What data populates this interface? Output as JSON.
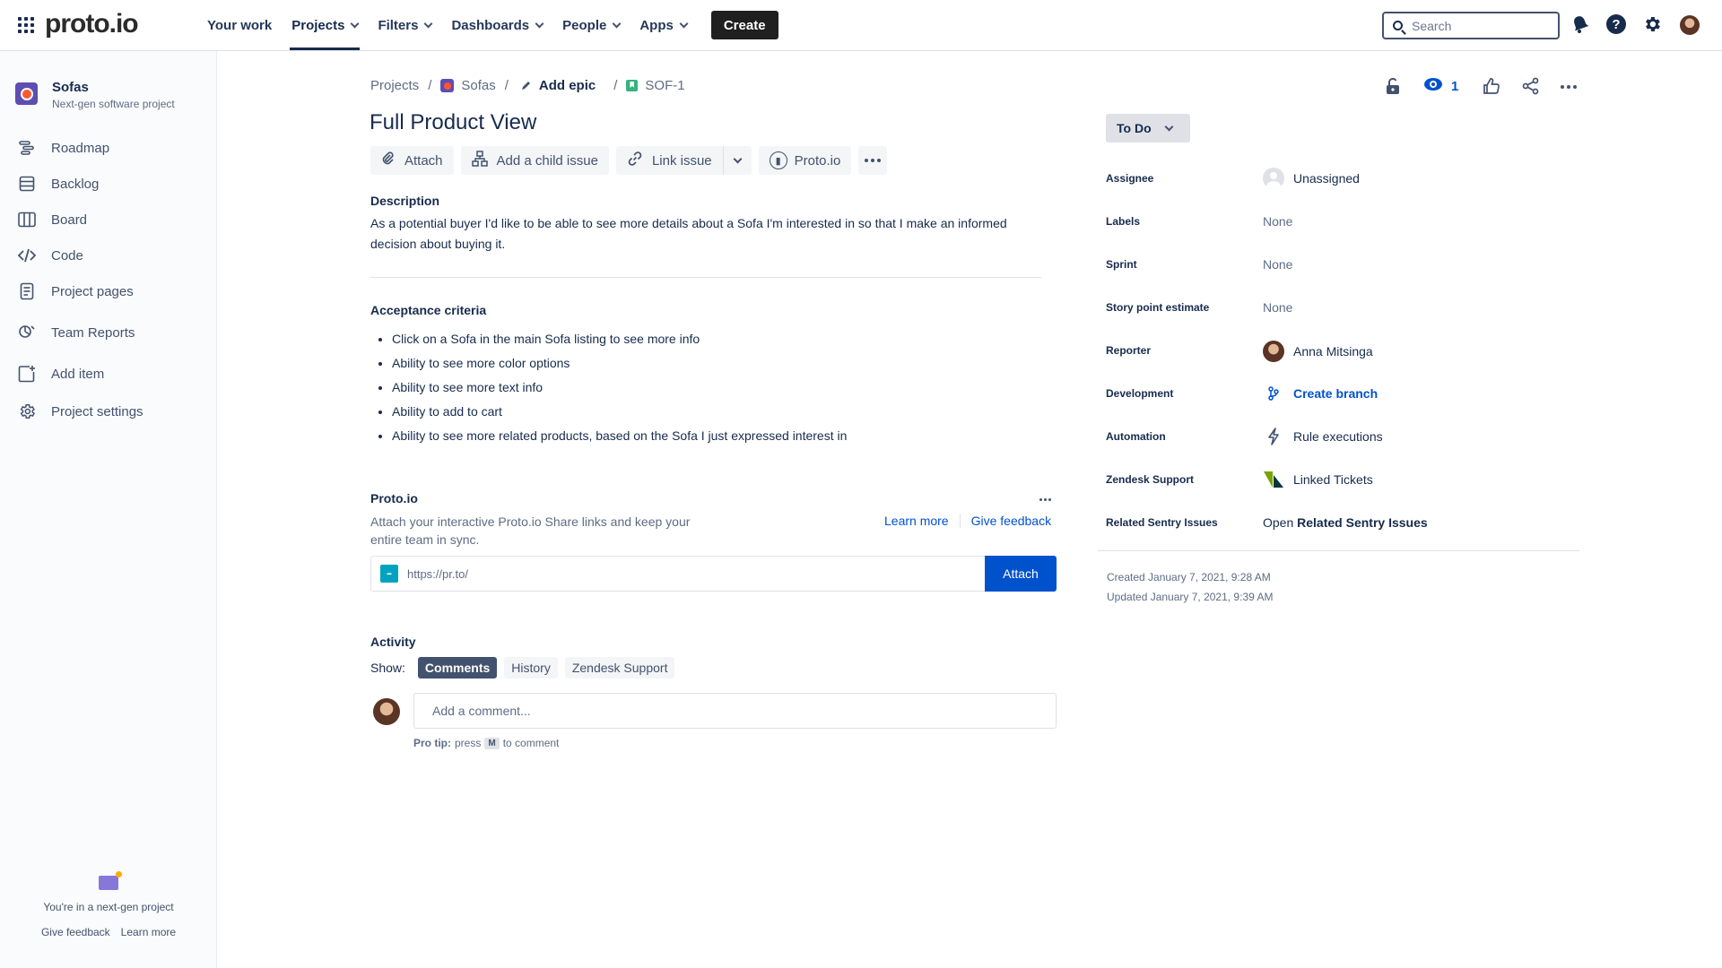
{
  "topnav": {
    "logo": "proto.io",
    "items": [
      {
        "label": "Your work"
      },
      {
        "label": "Projects"
      },
      {
        "label": "Filters"
      },
      {
        "label": "Dashboards"
      },
      {
        "label": "People"
      },
      {
        "label": "Apps"
      }
    ],
    "create_label": "Create",
    "search_placeholder": "Search",
    "help_glyph": "?"
  },
  "sidebar": {
    "project_name": "Sofas",
    "project_type": "Next-gen software project",
    "items": [
      {
        "label": "Roadmap",
        "icon": "roadmap-icon"
      },
      {
        "label": "Backlog",
        "icon": "backlog-icon"
      },
      {
        "label": "Board",
        "icon": "board-icon"
      },
      {
        "label": "Code",
        "icon": "code-icon"
      },
      {
        "label": "Project pages",
        "icon": "pages-icon"
      },
      {
        "label": "Team Reports",
        "icon": "reports-icon"
      },
      {
        "label": "Add item",
        "icon": "add-item-icon"
      },
      {
        "label": "Project settings",
        "icon": "settings-icon"
      }
    ],
    "footer_text": "You're in a next-gen project",
    "footer_feedback": "Give feedback",
    "footer_learn": "Learn more"
  },
  "breadcrumb": {
    "projects": "Projects",
    "project": "Sofas",
    "epic": "Add epic",
    "issue_key": "SOF-1",
    "separator": "/"
  },
  "issue": {
    "title": "Full Product View",
    "toolbar": {
      "attach": "Attach",
      "child_issue": "Add a child issue",
      "link_issue": "Link issue",
      "protoio": "Proto.io"
    },
    "description_heading": "Description",
    "description": "As a potential buyer I'd like to be able to see more details about a Sofa I'm interested in so that I make an informed decision about buying it.",
    "criteria_heading": "Acceptance criteria",
    "criteria": [
      "Click on a Sofa in the main Sofa listing to see more info",
      "Ability to see more color options",
      "Ability to see more text info",
      "Ability to add to cart",
      "Ability to see more related products, based on the Sofa I just expressed interest in"
    ]
  },
  "protoio_panel": {
    "heading": "Proto.io",
    "description": "Attach your interactive Proto.io Share links and keep your entire team in sync.",
    "learn_more": "Learn more",
    "give_feedback": "Give feedback",
    "url_placeholder": "https://pr.to/",
    "attach_label": "Attach"
  },
  "activity": {
    "heading": "Activity",
    "show_label": "Show:",
    "filters": [
      "Comments",
      "History",
      "Zendesk Support"
    ],
    "comment_placeholder": "Add a comment...",
    "protip_label": "Pro tip:",
    "protip_press": "press",
    "protip_key": "M",
    "protip_suffix": "to comment"
  },
  "right_panel": {
    "watch_count": "1",
    "status": "To Do",
    "fields": [
      {
        "label": "Assignee",
        "value": "Unassigned"
      },
      {
        "label": "Labels",
        "value": "None"
      },
      {
        "label": "Sprint",
        "value": "None"
      },
      {
        "label": "Story point estimate",
        "value": "None"
      },
      {
        "label": "Reporter",
        "value": "Anna Mitsinga"
      },
      {
        "label": "Development",
        "value": "Create branch"
      },
      {
        "label": "Automation",
        "value": "Rule executions"
      },
      {
        "label": "Zendesk Support",
        "value": "Linked Tickets"
      },
      {
        "label": "Related Sentry Issues",
        "value_prefix": "Open",
        "value": "Related Sentry Issues"
      }
    ],
    "created": "Created January 7, 2021, 9:28 AM",
    "updated": "Updated January 7, 2021, 9:39 AM"
  },
  "colors": {
    "accent": "#0052CC",
    "status_bg": "#DFE1E6",
    "text": "#172B4D"
  }
}
